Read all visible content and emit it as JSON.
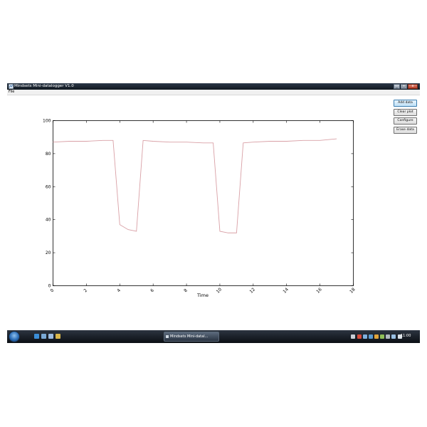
{
  "window": {
    "title": "Mindsets Mini-datalogger V1.0",
    "controls": [
      "_",
      "□",
      "x"
    ]
  },
  "menu": {
    "file_label": "File"
  },
  "side_buttons": {
    "add_data": "Add data",
    "clear_plot": "Clear plot",
    "configure": "Configure",
    "erase_data": "Erase data"
  },
  "chart_data": {
    "type": "line",
    "title": "",
    "xlabel": "Time",
    "ylabel": "",
    "xlim": [
      0,
      18
    ],
    "ylim": [
      0,
      100
    ],
    "x_ticks": [
      0,
      2,
      4,
      6,
      8,
      10,
      12,
      14,
      16,
      18
    ],
    "y_ticks": [
      0,
      20,
      40,
      60,
      80,
      100
    ],
    "grid": false,
    "series": [
      {
        "color": "#d9a0a6",
        "x": [
          0,
          1,
          2,
          3,
          3.3,
          3.6,
          4,
          4.5,
          5,
          5.4,
          6,
          7,
          8,
          9,
          9.6,
          10,
          10.5,
          11,
          11.4,
          12,
          13,
          14,
          15,
          15.5,
          16,
          16.5,
          17
        ],
        "y": [
          87,
          87.5,
          87.5,
          88,
          88,
          88,
          37,
          34,
          33,
          88,
          87.5,
          87,
          87,
          86.5,
          86.5,
          33,
          32,
          32,
          86.5,
          87,
          87.5,
          87.5,
          88,
          88,
          88,
          88.5,
          89
        ]
      }
    ]
  },
  "taskbar": {
    "task_label": "Mindsets Mini-datal...",
    "clock": "11:00"
  }
}
